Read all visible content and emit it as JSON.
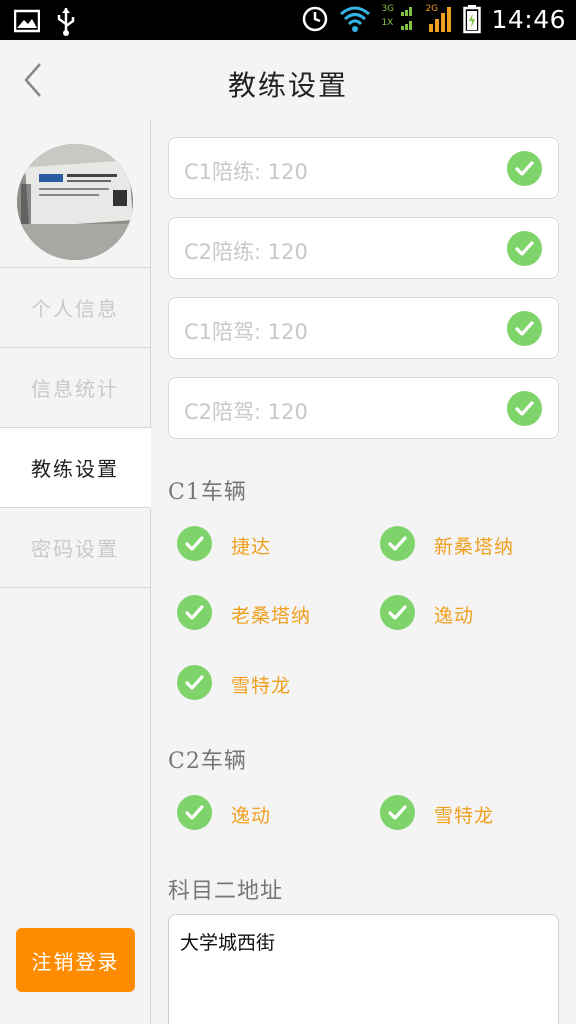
{
  "status_bar": {
    "time": "14:46",
    "network_a": "3G",
    "network_b": "1X",
    "network_c": "2G",
    "icons": [
      "gallery-icon",
      "usb-icon",
      "alarm-icon",
      "wifi-icon",
      "signal-icon",
      "battery-icon"
    ]
  },
  "header": {
    "title": "教练设置"
  },
  "sidebar": {
    "items": [
      {
        "label": "个人信息"
      },
      {
        "label": "信息统计"
      },
      {
        "label": "教练设置"
      },
      {
        "label": "密码设置"
      }
    ],
    "active_index": 2,
    "logout_label": "注销登录"
  },
  "prices": [
    {
      "text": "C1陪练: 120",
      "checked": true
    },
    {
      "text": "C2陪练: 120",
      "checked": true
    },
    {
      "text": "C1陪驾: 120",
      "checked": true
    },
    {
      "text": "C2陪驾: 120",
      "checked": true
    }
  ],
  "c1": {
    "title": "C1车辆",
    "options": [
      {
        "label": "捷达",
        "checked": true
      },
      {
        "label": "新桑塔纳",
        "checked": true
      },
      {
        "label": "老桑塔纳",
        "checked": true
      },
      {
        "label": "逸动",
        "checked": true
      },
      {
        "label": "雪特龙",
        "checked": true
      }
    ]
  },
  "c2": {
    "title": "C2车辆",
    "options": [
      {
        "label": "逸动",
        "checked": true
      },
      {
        "label": "雪特龙",
        "checked": true
      }
    ]
  },
  "address": {
    "title": "科目二地址",
    "value": "大学城西街"
  },
  "colors": {
    "accent": "#ff8c00",
    "option_text": "#f0a020",
    "check_green": "#7ed36a"
  }
}
